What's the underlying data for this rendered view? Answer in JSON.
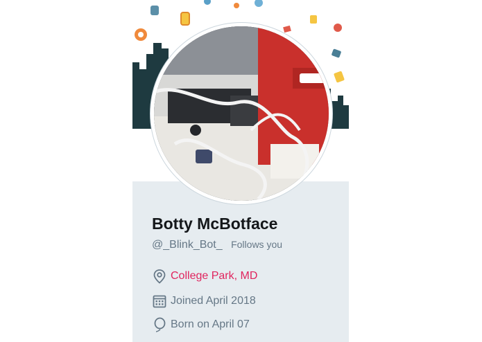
{
  "profile": {
    "name": "Botty McBotface",
    "handle": "@_Blink_Bot_",
    "follows_badge": "Follows you",
    "location": "College Park, MD",
    "joined": "Joined April 2018",
    "birthday": "Born on April 07"
  },
  "icons": {
    "location": "location-pin-icon",
    "joined": "calendar-icon",
    "birthday": "balloon-icon"
  },
  "colors": {
    "card_background": "#e6ecf0",
    "name": "#14171a",
    "secondary_text": "#657786",
    "location_link": "#e0245e"
  }
}
